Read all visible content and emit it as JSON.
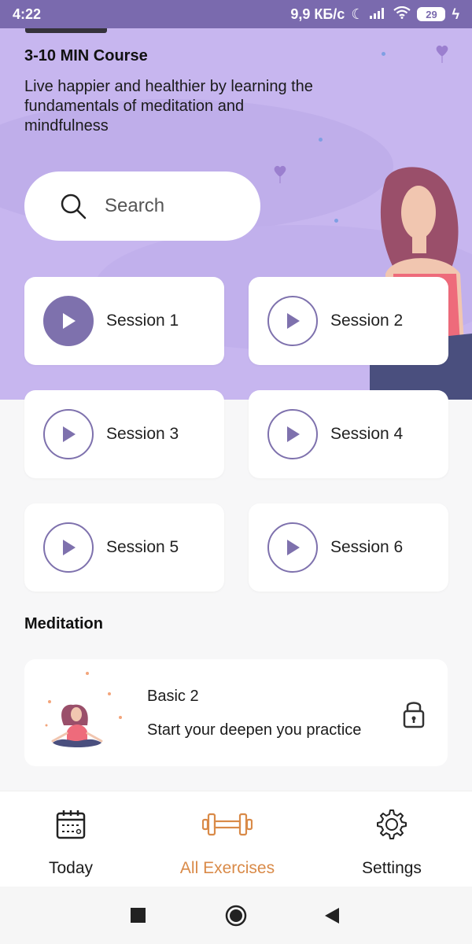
{
  "status_bar": {
    "time": "4:22",
    "network_speed": "9,9 КБ/с",
    "battery": "29"
  },
  "course": {
    "cut_heading": "Meditation",
    "title": "3-10 MIN Course",
    "description": "Live happier and healthier by learning the fundamentals of meditation and mindfulness"
  },
  "search": {
    "placeholder": "Search",
    "icon": "search-icon"
  },
  "sessions": [
    {
      "label": "Session 1",
      "active": true
    },
    {
      "label": "Session 2",
      "active": false
    },
    {
      "label": "Session 3",
      "active": false
    },
    {
      "label": "Session 4",
      "active": false
    },
    {
      "label": "Session 5",
      "active": false
    },
    {
      "label": "Session 6",
      "active": false
    }
  ],
  "meditation_section": {
    "title": "Meditation",
    "card": {
      "title": "Basic 2",
      "subtitle": "Start your deepen you practice",
      "locked": true
    }
  },
  "bottom_nav": [
    {
      "label": "Today",
      "icon": "calendar-icon",
      "active": false
    },
    {
      "label": "All Exercises",
      "icon": "dumbbell-icon",
      "active": true
    },
    {
      "label": "Settings",
      "icon": "gear-icon",
      "active": false
    }
  ],
  "colors": {
    "hero_bg": "#c7b6ef",
    "accent_purple": "#7e71ad",
    "active_nav": "#d98a48",
    "status_bar": "#7a6aae"
  }
}
